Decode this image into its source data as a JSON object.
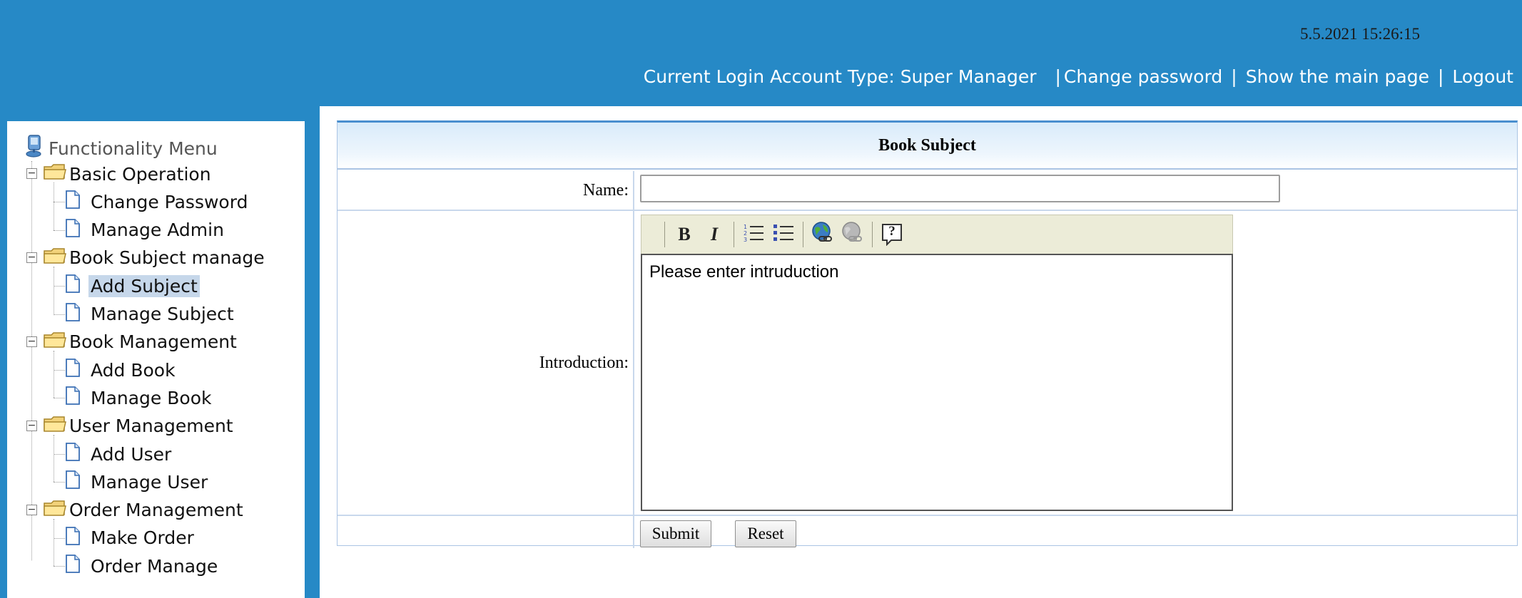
{
  "header": {
    "datetime": "5.5.2021 15:26:15",
    "account_type": "Current Login Account Type: Super Manager",
    "separator": "|",
    "links": [
      "Change password",
      "Show the main page",
      "Logout"
    ]
  },
  "sidebar": {
    "title": "Functionality Menu",
    "groups": [
      {
        "label": "Basic Operation",
        "items": [
          "Change Password",
          "Manage Admin"
        ]
      },
      {
        "label": "Book Subject manage",
        "items": [
          "Add Subject",
          "Manage Subject"
        ]
      },
      {
        "label": "Book Management",
        "items": [
          "Add Book",
          "Manage Book"
        ]
      },
      {
        "label": "User Management",
        "items": [
          "Add User",
          "Manage User"
        ]
      },
      {
        "label": "Order Management",
        "items": [
          "Make Order",
          "Order Manage"
        ]
      }
    ],
    "selected": "Add Subject",
    "expand_symbol": "−"
  },
  "form": {
    "title": "Book Subject",
    "name_label": "Name:",
    "name_value": "",
    "intro_label": "Introduction:",
    "intro_text": "Please enter intruduction",
    "toolbar": {
      "bold": "B",
      "italic": "I",
      "help": "?",
      "icons": [
        "bold-icon",
        "italic-icon",
        "ordered-list-icon",
        "unordered-list-icon",
        "insert-link-icon",
        "remove-link-icon",
        "help-icon"
      ]
    },
    "submit_label": "Submit",
    "reset_label": "Reset"
  },
  "colors": {
    "background": "#2689c6",
    "panel_border": "#aac4e4",
    "selected": "#c6d7ea",
    "toolbar": "#ececd8"
  }
}
